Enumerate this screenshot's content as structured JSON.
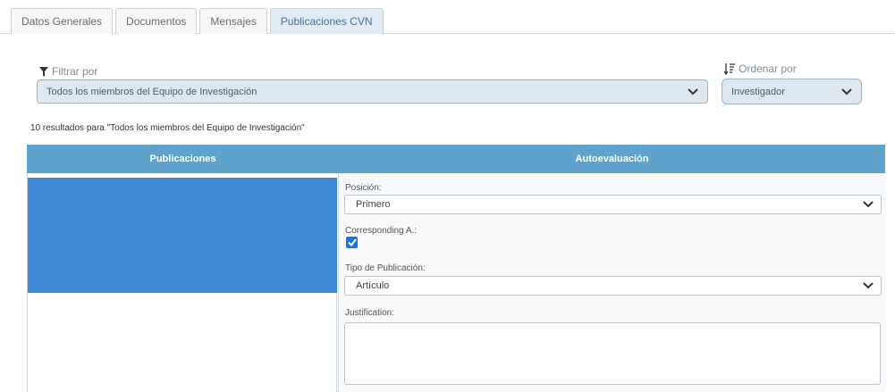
{
  "tabs": [
    {
      "label": "Datos Generales"
    },
    {
      "label": "Documentos"
    },
    {
      "label": "Mensajes"
    },
    {
      "label": "Publicaciones CVN",
      "active": true
    }
  ],
  "filter": {
    "label": "Filtrar por",
    "selected": "Todos los miembros del Equipo de Investigación"
  },
  "order": {
    "label": "Ordenar por",
    "selected": "Investigador"
  },
  "results_text": "10 resultados para \"Todos los miembros del Equipo de Investigación\"",
  "table": {
    "headers": [
      "Publicaciones",
      "Autoevaluación"
    ]
  },
  "form": {
    "posicion_label": "Posición:",
    "posicion_value": "Primero",
    "corresponding_label": "Corresponding A.:",
    "corresponding_checked": true,
    "tipo_label": "Tipo de Publicación:",
    "tipo_value": "Artículo",
    "justification_label": "Justification:",
    "justification_value": ""
  },
  "colors": {
    "header_bg": "#5fa3cc",
    "selected_cell": "#3f88d3",
    "checkbox": "#1a73e8"
  }
}
